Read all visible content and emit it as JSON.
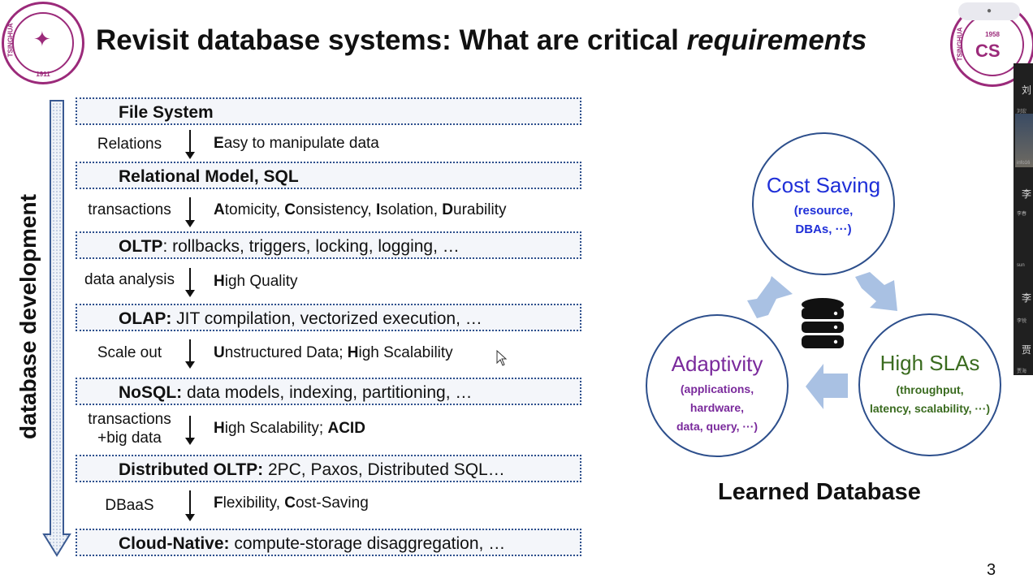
{
  "slide": {
    "title_main": "Revisit database systems:  What are critical ",
    "title_emph": "requirements",
    "page_number": "3",
    "vertical_label": "database development"
  },
  "logos": {
    "left_seal_text": "1911",
    "left_seal_name": "TSINGHUA",
    "right_seal_year": "1958",
    "right_seal_name": "TSINGHUA"
  },
  "stages": [
    {
      "bold": "File System",
      "rest": ""
    },
    {
      "bold": "Relational Model, SQL",
      "rest": ""
    },
    {
      "bold": "OLTP",
      "rest": ": rollbacks, triggers, locking, logging, …"
    },
    {
      "bold": "OLAP:",
      "rest": " JIT compilation, vectorized execution, …"
    },
    {
      "bold": "NoSQL:",
      "rest": " data models, indexing, partitioning, …"
    },
    {
      "bold": "Distributed OLTP:",
      "rest": " 2PC, Paxos, Distributed SQL…"
    },
    {
      "bold": "Cloud-Native:",
      "rest": " compute-storage disaggregation, …"
    }
  ],
  "transitions": [
    {
      "left": "Relations",
      "right_bold_1": "E",
      "right_rest_1": "asy to manipulate data"
    },
    {
      "left": "transactions",
      "right_bold_1": "A",
      "right_rest_1": "tomicity, ",
      "right_bold_2": "C",
      "right_rest_2": "onsistency, ",
      "right_bold_3": "I",
      "right_rest_3": "solation, ",
      "right_bold_4": "D",
      "right_rest_4": "urability"
    },
    {
      "left": "data analysis",
      "right_bold_1": "H",
      "right_rest_1": "igh Quality"
    },
    {
      "left": "Scale out",
      "right_bold_1": "U",
      "right_rest_1": "nstructured Data; ",
      "right_bold_2": "H",
      "right_rest_2": "igh Scalability"
    },
    {
      "left_line1": "transactions",
      "left_line2": "+big data",
      "right_bold_1": "H",
      "right_rest_1": "igh Scalability; ",
      "right_bold_2": "ACID"
    },
    {
      "left": "DBaaS",
      "right_bold_1": "F",
      "right_rest_1": "lexibility, ",
      "right_bold_2": "C",
      "right_rest_2": "ost-Saving"
    }
  ],
  "cycle": {
    "cost": {
      "title": "Cost Saving",
      "sub_line1": "(resource,",
      "sub_line2": "DBAs, ···)",
      "color": "#1f2fd8"
    },
    "slas": {
      "title": "High SLAs",
      "sub_line1": "(throughput,",
      "sub_line2": "latency, scalability, ···)",
      "color": "#3a6b1f"
    },
    "adapt": {
      "title": "Adaptivity",
      "sub_line1": "(applications,",
      "sub_line2": "hardware,",
      "sub_line3": "data, query, ···)",
      "color": "#7a2a9c"
    },
    "caption": "Learned Database",
    "arrow_color": "#a9c1e3"
  },
  "sidebar": {
    "names": [
      "刘",
      "李",
      "李",
      "贾"
    ],
    "tiny": [
      "刘宏",
      "info16",
      "李春",
      "sun",
      "李锐",
      "贾海"
    ]
  }
}
